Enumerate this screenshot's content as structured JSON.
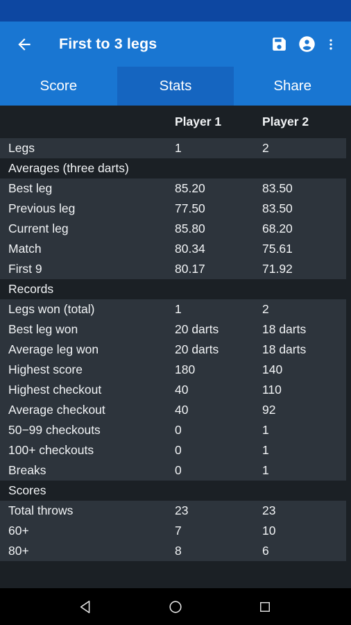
{
  "status_bar": {
    "color": "#0d47a1"
  },
  "app_bar": {
    "title": "First to 3 legs",
    "back_label": "Back",
    "save_label": "Save",
    "account_label": "Account",
    "overflow_label": "More options",
    "color": "#1976d2"
  },
  "tabs": {
    "selected_index": 1,
    "selected_color": "#1565c0",
    "items": [
      {
        "label": "Score"
      },
      {
        "label": "Stats"
      },
      {
        "label": "Share"
      }
    ]
  },
  "table": {
    "columns": {
      "label": "",
      "player1": "Player 1",
      "player2": "Player 2"
    },
    "rows": [
      {
        "type": "data",
        "label": "Legs",
        "p1": "1",
        "p2": "2"
      },
      {
        "type": "section",
        "label": "Averages (three darts)",
        "p1": "",
        "p2": ""
      },
      {
        "type": "data",
        "label": "Best leg",
        "p1": "85.20",
        "p2": "83.50"
      },
      {
        "type": "data",
        "label": "Previous leg",
        "p1": "77.50",
        "p2": "83.50"
      },
      {
        "type": "data",
        "label": "Current leg",
        "p1": "85.80",
        "p2": "68.20"
      },
      {
        "type": "data",
        "label": "Match",
        "p1": "80.34",
        "p2": "75.61"
      },
      {
        "type": "data",
        "label": "First 9",
        "p1": "80.17",
        "p2": "71.92"
      },
      {
        "type": "section",
        "label": "Records",
        "p1": "",
        "p2": ""
      },
      {
        "type": "data",
        "label": "Legs won (total)",
        "p1": "1",
        "p2": "2"
      },
      {
        "type": "data",
        "label": "Best leg won",
        "p1": "20 darts",
        "p2": "18 darts"
      },
      {
        "type": "data",
        "label": "Average leg won",
        "p1": "20 darts",
        "p2": "18 darts"
      },
      {
        "type": "data",
        "label": "Highest score",
        "p1": "180",
        "p2": "140"
      },
      {
        "type": "data",
        "label": "Highest checkout",
        "p1": "40",
        "p2": "110"
      },
      {
        "type": "data",
        "label": "Average checkout",
        "p1": "40",
        "p2": "92"
      },
      {
        "type": "data",
        "label": "50−99 checkouts",
        "p1": "0",
        "p2": "1"
      },
      {
        "type": "data",
        "label": "100+ checkouts",
        "p1": "0",
        "p2": "1"
      },
      {
        "type": "data",
        "label": "Breaks",
        "p1": "0",
        "p2": "1"
      },
      {
        "type": "section",
        "label": "Scores",
        "p1": "",
        "p2": ""
      },
      {
        "type": "data",
        "label": "Total throws",
        "p1": "23",
        "p2": "23"
      },
      {
        "type": "data",
        "label": "60+",
        "p1": "7",
        "p2": "10"
      },
      {
        "type": "data",
        "label": "80+",
        "p1": "8",
        "p2": "6"
      }
    ]
  },
  "nav_bar": {
    "back_label": "Back",
    "home_label": "Home",
    "recents_label": "Recent apps"
  }
}
